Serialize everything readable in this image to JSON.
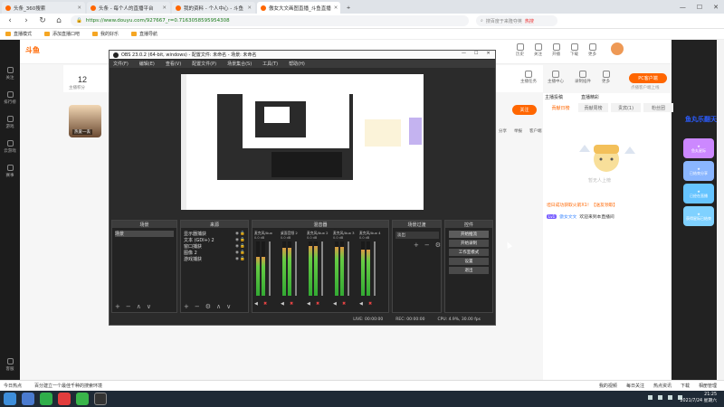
{
  "browser": {
    "tabs": [
      {
        "title": "头条_360搜索",
        "active": false
      },
      {
        "title": "头条 - 每个人的直播平台",
        "active": false
      },
      {
        "title": "我的资料 - 个人中心 - 斗鱼",
        "active": false
      },
      {
        "title": "傲女大文画图直播_斗鱼直播",
        "active": true
      }
    ],
    "url": "https://www.douyu.com/927667_r=0.7163058595954308",
    "search_placeholder": "搜百度于来隆夺英",
    "search_hot": "热搜",
    "bookmarks": [
      "直播模式",
      "添加直播口吧",
      "我的好乐",
      "直播导航"
    ]
  },
  "douyu": {
    "left_nav": [
      "关注",
      "排行榜",
      "游戏",
      "云游戏",
      "赛事",
      "客服"
    ],
    "fans_count": "12",
    "fans_label": "主播积分",
    "head_icons": [
      "历史",
      "关注",
      "开播",
      "下载",
      "更多"
    ],
    "anchor_icons": [
      "主播任务",
      "主播中心",
      "录制插件",
      "更多"
    ],
    "pc_btn": "PC客户端",
    "pc_sub": "点播客户端上线",
    "streamer_name": "热爱一丢",
    "follow_btn": "关注",
    "share": [
      "分享",
      "举报",
      "客户端"
    ],
    "rp_live": [
      "主播投稿",
      "直播精彩"
    ],
    "rp_tabs": [
      "贡献日榜",
      "贡献周榜",
      "贵宾(1)",
      "粉丝团"
    ],
    "rank_empty": "暂无人上榜",
    "chat_msg1": "坦日成功获取火箭X1！【送友领取】",
    "chat_level": "Lv1",
    "chat_nick": "傲女文文",
    "chat_text": "欢迎来到本直播间",
    "promo_title": "鱼丸乐翻天",
    "promo_items": [
      "鱼丸星际",
      "已结束分享",
      "已经在直播",
      "获得星际已结束"
    ]
  },
  "obs": {
    "title": "OBS 23.0.2 (64-bit, windows) - 配置文件: 未命名 - 场景: 未命名",
    "menu": [
      "文件(F)",
      "编辑(E)",
      "查看(V)",
      "配置文件(P)",
      "场景集合(S)",
      "工具(T)",
      "帮助(H)"
    ],
    "docks": {
      "scenes": "场景",
      "sources": "来源",
      "mixer": "混音器",
      "transitions": "场景过渡",
      "controls": "控件"
    },
    "scenes": [
      "场景"
    ],
    "sources": [
      "显示器捕获",
      "文本 (GDI+) 2",
      "窗口捕获",
      "图像 2",
      "游戏捕获"
    ],
    "mixer": [
      {
        "name": "麦克风/Aux",
        "db": "0.0 dB",
        "level": 0.72
      },
      {
        "name": "桌面音频 2",
        "db": "0.0 dB",
        "level": 0.88
      },
      {
        "name": "麦克风/Aux 2",
        "db": "0.0 dB",
        "level": 0.92
      },
      {
        "name": "麦克风/Aux 3",
        "db": "0.0 dB",
        "level": 0.9
      },
      {
        "name": "麦克风/Aux 4",
        "db": "0.0 dB",
        "level": 0.85
      }
    ],
    "transition": "淡出",
    "controls": [
      "开始推流",
      "开始录制",
      "工作室模式",
      "设置",
      "退出"
    ],
    "status": {
      "live": "LIVE: 00:00:00",
      "rec": "REC: 00:00:00",
      "cpu": "CPU: 4.9%, 30.00 fps"
    }
  },
  "bottom": {
    "left": [
      "今日热点",
      "百分建立一个最佳千种的搜索环境"
    ],
    "right": [
      "我的视频",
      "每日关注",
      "热点资讯",
      "下载",
      "相册管理"
    ]
  },
  "taskbar": {
    "time": "21:25",
    "date": "2021/7/24 星期六"
  }
}
